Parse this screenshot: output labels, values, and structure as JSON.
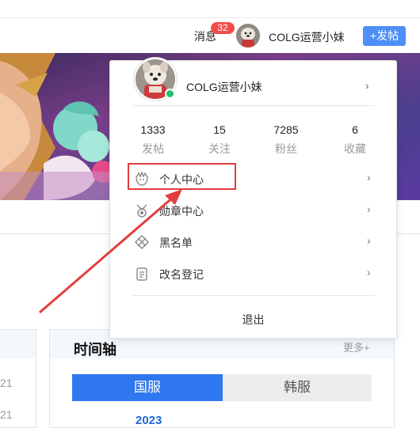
{
  "header": {
    "messages_label": "消息",
    "messages_badge": "32",
    "username": "COLG运营小妹",
    "post_button": "+发帖"
  },
  "left_panel": {
    "numbers": [
      "21",
      "21"
    ]
  },
  "timeline": {
    "title": "时间轴",
    "more": "更多+",
    "tabs": [
      "国服",
      "韩服"
    ],
    "year": "2023"
  },
  "dropdown": {
    "username": "COLG运营小妹",
    "stats": [
      {
        "value": "1333",
        "label": "发帖"
      },
      {
        "value": "15",
        "label": "关注"
      },
      {
        "value": "7285",
        "label": "粉丝"
      },
      {
        "value": "6",
        "label": "收藏"
      }
    ],
    "menu": [
      {
        "label": "个人中心",
        "icon": "personal-center-icon"
      },
      {
        "label": "勋章中心",
        "icon": "medal-icon"
      },
      {
        "label": "黑名单",
        "icon": "blacklist-icon"
      },
      {
        "label": "改名登记",
        "icon": "rename-icon"
      }
    ],
    "logout": "退出",
    "chevron": "›"
  },
  "colors": {
    "accent": "#2f77ee",
    "highlight": "#e33d3d",
    "badge": "#f24b4b",
    "online": "#23c16b"
  }
}
